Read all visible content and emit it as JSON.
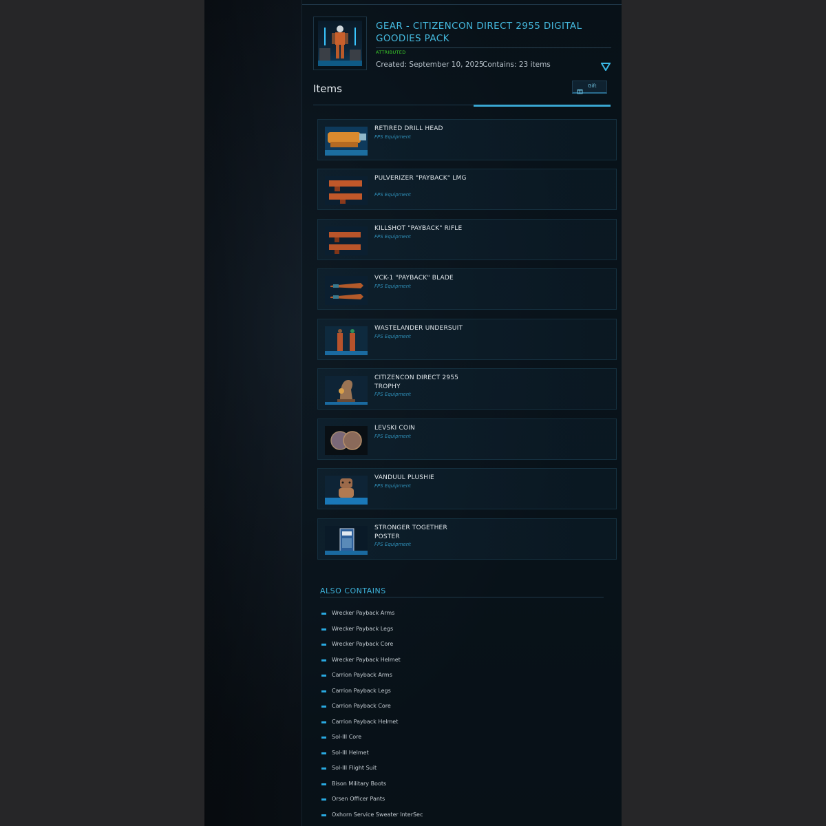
{
  "pack": {
    "title": "GEAR - CITIZENCON DIRECT 2955 DIGITAL GOODIES PACK",
    "status": "ATTRIBUTED",
    "created": "Created: September 10, 2025",
    "contains": "Contains: 23 items",
    "thumb_icon": "pack-character-thumbnail"
  },
  "items_section": {
    "title": "Items",
    "gift_label": "Gift",
    "gift_icon": "gift-icon"
  },
  "items": [
    {
      "name": "RETIRED DRILL HEAD",
      "type": "FPS Equipment"
    },
    {
      "name": "PULVERIZER \"PAYBACK\" LMG",
      "type": "FPS Equipment"
    },
    {
      "name": "KILLSHOT \"PAYBACK\" RIFLE",
      "type": "FPS Equipment"
    },
    {
      "name": "VCK-1 \"PAYBACK\" BLADE",
      "type": "FPS Equipment"
    },
    {
      "name": "WASTELANDER UNDERSUIT",
      "type": "FPS Equipment"
    },
    {
      "name": "CITIZENCON DIRECT 2955 TROPHY",
      "type": "FPS Equipment"
    },
    {
      "name": "LEVSKI COIN",
      "type": "FPS Equipment"
    },
    {
      "name": "VANDUUL PLUSHIE",
      "type": "FPS Equipment"
    },
    {
      "name": "STRONGER TOGETHER POSTER",
      "type": "FPS Equipment"
    }
  ],
  "also_contains": {
    "title": "ALSO CONTAINS",
    "items": [
      "Wrecker Payback Arms",
      "Wrecker Payback Legs",
      "Wrecker Payback Core",
      "Wrecker Payback Helmet",
      "Carrion Payback Arms",
      "Carrion Payback Legs",
      "Carrion Payback Core",
      "Carrion Payback Helmet",
      "Sol-III Core",
      "Sol-III Helmet",
      "Sol-III Flight Suit",
      "Bison Military Boots",
      "Orsen Officer Pants",
      "Oxhorn Service Sweater InterSec"
    ]
  },
  "colors": {
    "accent": "#3eb4dc",
    "attributed": "#3ccd2a",
    "item_type": "#2f8fb8"
  }
}
